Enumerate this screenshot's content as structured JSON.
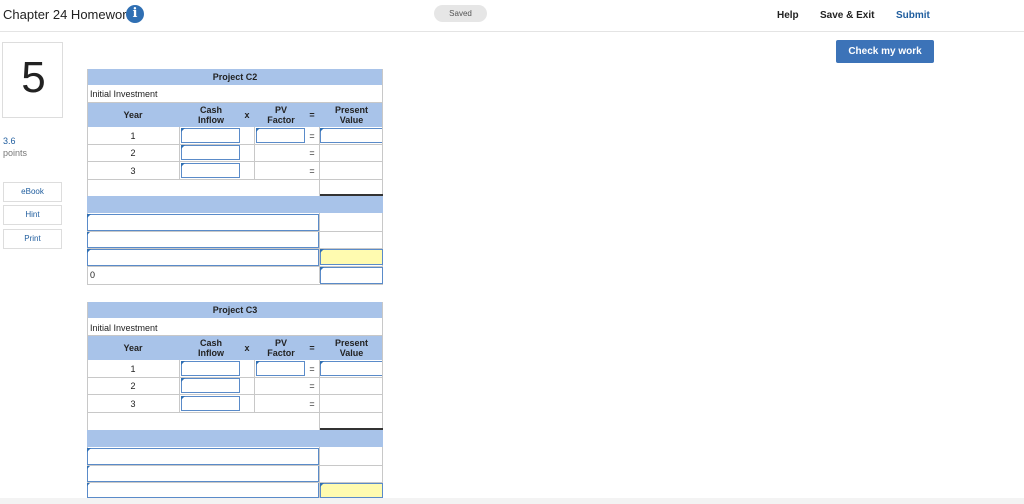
{
  "header": {
    "title": "Chapter 24 Homework",
    "info_icon": "i",
    "saved": "Saved",
    "help": "Help",
    "save_exit": "Save & Exit",
    "submit": "Submit"
  },
  "sidebar": {
    "question_number": "5",
    "points_value": "3.6",
    "points_label": "points",
    "ebook": "eBook",
    "hint": "Hint",
    "print": "Print"
  },
  "check_work": "Check my work",
  "project_c2": {
    "title": "Project C2",
    "initial_investment": "Initial Investment",
    "col_year": "Year",
    "col_cash_1": "Cash",
    "col_cash_2": "Inflow",
    "col_x": "x",
    "col_pv_1": "PV",
    "col_pv_2": "Factor",
    "col_eq": "=",
    "col_present_1": "Present",
    "col_present_2": "Value",
    "years": [
      "1",
      "2",
      "3"
    ],
    "eq": "=",
    "zero_value": "0"
  },
  "project_c3": {
    "title": "Project C3",
    "initial_investment": "Initial Investment",
    "col_year": "Year",
    "col_cash_1": "Cash",
    "col_cash_2": "Inflow",
    "col_x": "x",
    "col_pv_1": "PV",
    "col_pv_2": "Factor",
    "col_eq": "=",
    "col_present_1": "Present",
    "col_present_2": "Value",
    "years": [
      "1",
      "2",
      "3"
    ],
    "eq": "="
  }
}
